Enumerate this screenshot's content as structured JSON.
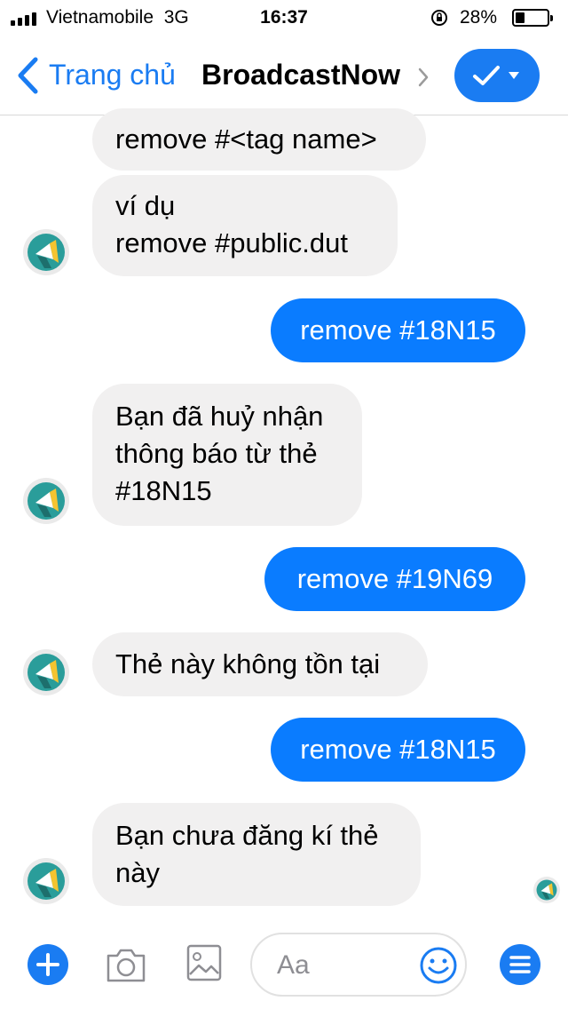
{
  "status_bar": {
    "carrier": "Vietnamobile",
    "network": "3G",
    "time": "16:37",
    "battery": "28%",
    "battery_level": 0.28
  },
  "header": {
    "back_label": "Trang chủ",
    "title": "BroadcastNow"
  },
  "messages": [
    {
      "from": "bot",
      "text": "remove #<tag name>"
    },
    {
      "from": "bot",
      "text": "ví dụ\nremove #public.dut"
    },
    {
      "from": "user",
      "text": "remove #18N15"
    },
    {
      "from": "bot",
      "text": "Bạn đã huỷ nhận\nthông báo từ thẻ\n#18N15"
    },
    {
      "from": "user",
      "text": "remove #19N69"
    },
    {
      "from": "bot",
      "text": "Thẻ này không tồn tại"
    },
    {
      "from": "user",
      "text": "remove #18N15"
    },
    {
      "from": "bot",
      "text": "Bạn chưa đăng kí thẻ\nnày"
    }
  ],
  "composer": {
    "placeholder": "Aa"
  },
  "icons": {
    "signal": "signal-bars-icon",
    "lock": "rotation-lock-icon",
    "back": "back-chevron-icon",
    "check": "check-icon",
    "plus": "plus-icon",
    "camera": "camera-icon",
    "gallery": "gallery-icon",
    "emoji": "smile-icon",
    "menu": "menu-icon"
  },
  "colors": {
    "accent": "#1a7cf2",
    "outgoing_bubble": "#0a7cff",
    "incoming_bubble": "#f1f0f0",
    "bot_avatar_teal": "#2a9d9a",
    "bot_avatar_yellow": "#f4c430"
  }
}
